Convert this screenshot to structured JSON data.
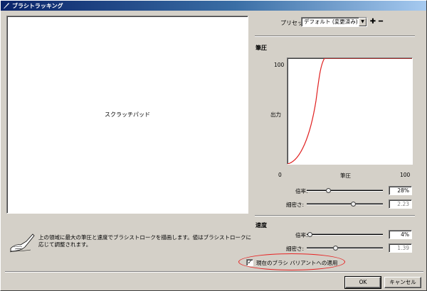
{
  "window": {
    "title": "ブラシトラッキング"
  },
  "scratchpad": {
    "label": "スクラッチパッド"
  },
  "help": {
    "text": "上の領域に最大の筆圧と速度でブラシストロークを描画します。値はブラシストロークに応じて調整されます。"
  },
  "preset": {
    "label": "プリセット:",
    "value": "デフォルト (変更済み)"
  },
  "pressure": {
    "title": "筆圧",
    "curve": {
      "y_label": "出力",
      "x_label": "筆圧",
      "y_max_label": "100",
      "x_min_label": "0",
      "x_max_label": "100"
    },
    "rate": {
      "label": "倍率:",
      "value": "28%",
      "fraction": 0.28
    },
    "fineness": {
      "label": "細密さ:",
      "value": "2.23",
      "fraction": 0.65
    }
  },
  "velocity": {
    "title": "速度",
    "rate": {
      "label": "倍率:",
      "value": "4%",
      "fraction": 0.04
    },
    "fineness": {
      "label": "細密さ:",
      "value": "1.39",
      "fraction": 0.38
    }
  },
  "apply_variants": {
    "label": "現在のブラシ バリアントへの適用",
    "checked": true,
    "check_glyph": "✓"
  },
  "buttons": {
    "ok": "OK",
    "cancel": "キャンセル"
  },
  "colors": {
    "curve": "#e02020",
    "title_start": "#0a246a",
    "highlight": "#e82323"
  }
}
